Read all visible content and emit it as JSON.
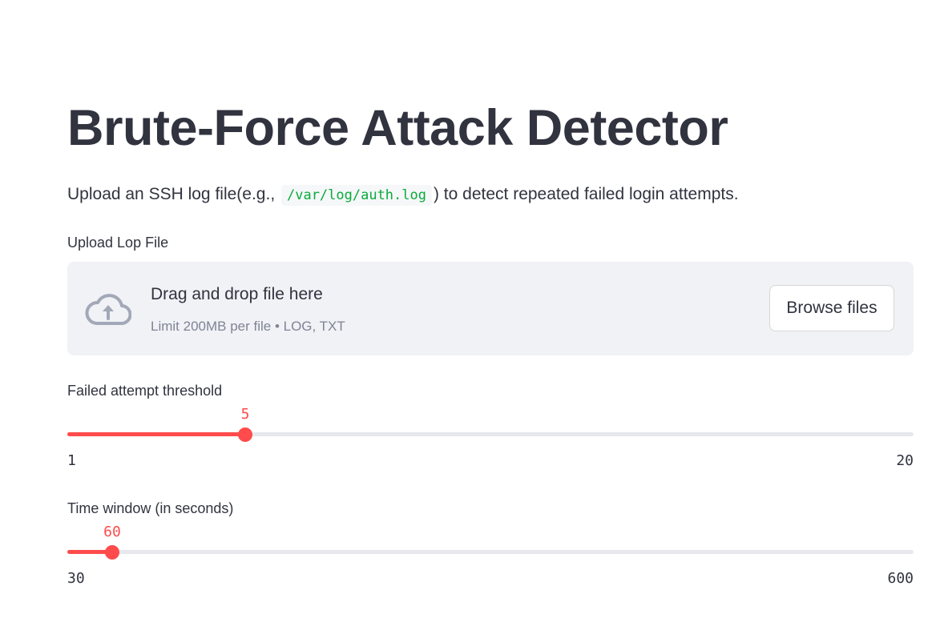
{
  "page": {
    "title": "Brute-Force Attack Detector",
    "description_before": "Upload an SSH log file(e.g., ",
    "description_code": "/var/log/auth.log",
    "description_after": ") to detect repeated failed login attempts."
  },
  "uploader": {
    "label": "Upload Lop File",
    "drag_text": "Drag and drop file here",
    "limit_text": "Limit 200MB per file • LOG, TXT",
    "browse_label": "Browse files",
    "icon": "cloud-upload-icon"
  },
  "sliders": [
    {
      "label": "Failed attempt threshold",
      "value": 5,
      "min": 1,
      "max": 20,
      "value_text": "5",
      "min_text": "1",
      "max_text": "20"
    },
    {
      "label": "Time window (in seconds)",
      "value": 60,
      "min": 30,
      "max": 600,
      "value_text": "60",
      "min_text": "30",
      "max_text": "600"
    }
  ],
  "colors": {
    "accent": "#ff4b4b",
    "text": "#31333f",
    "muted": "#808495",
    "code": "#09ab3b",
    "dropzone_bg": "#f0f2f6",
    "track": "#e6e8ee"
  }
}
